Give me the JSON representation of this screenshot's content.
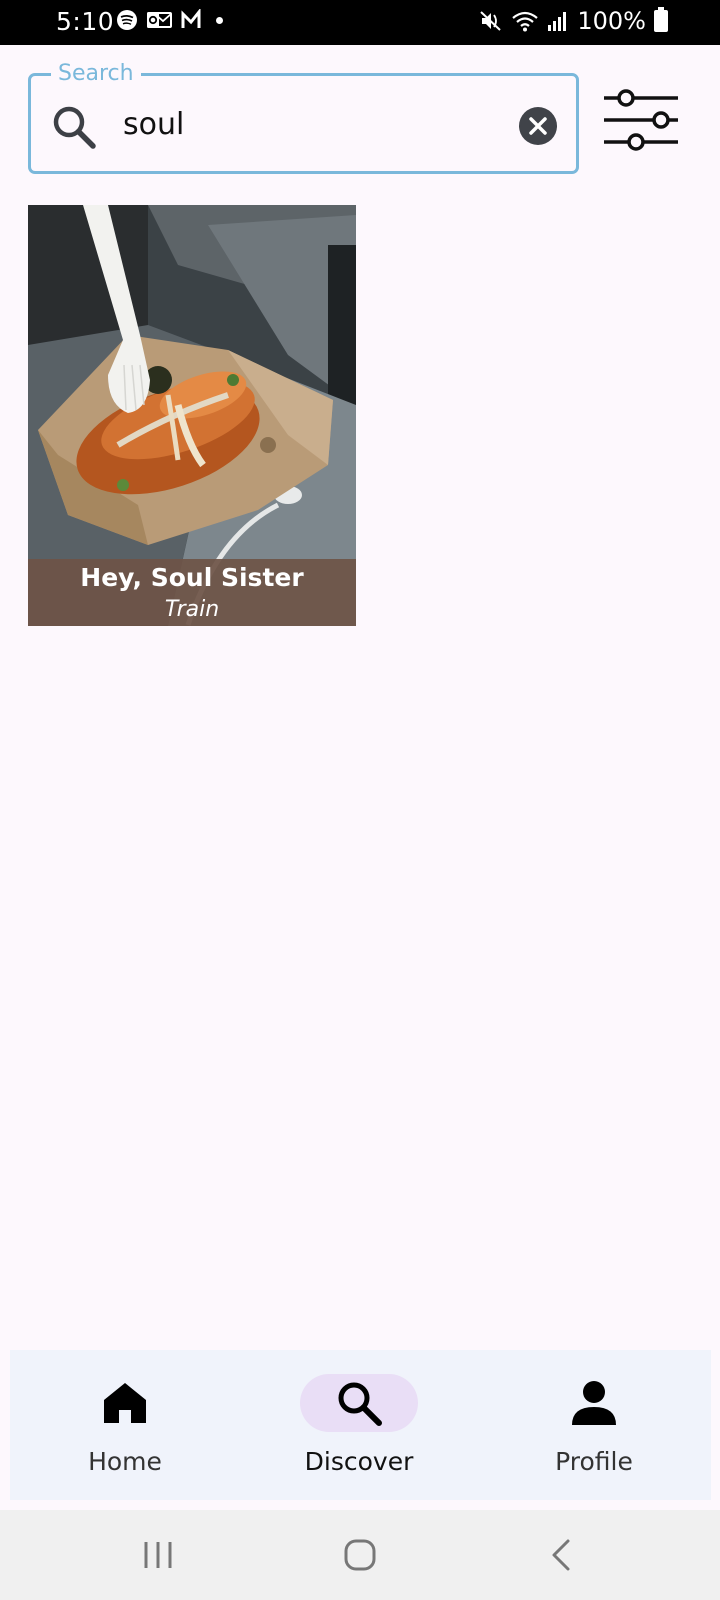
{
  "status_bar": {
    "time": "5:10",
    "battery": "100%"
  },
  "search": {
    "label": "Search",
    "value": "soul",
    "placeholder": "Search"
  },
  "results": [
    {
      "title": "Hey, Soul Sister",
      "subtitle": "Train"
    }
  ],
  "bottom_nav": {
    "items": [
      {
        "label": "Home",
        "icon": "home-icon",
        "active": false
      },
      {
        "label": "Discover",
        "icon": "search-icon",
        "active": true
      },
      {
        "label": "Profile",
        "icon": "person-icon",
        "active": false
      }
    ]
  },
  "colors": {
    "accent": "#7ab8db",
    "background": "#fdf8fd",
    "nav_background": "#f0f3fb",
    "active_pill": "#e9def6",
    "caption_background": "#6e5446"
  },
  "system_nav": {
    "icons": [
      "recent-apps-icon",
      "home-circle-icon",
      "back-icon"
    ]
  }
}
